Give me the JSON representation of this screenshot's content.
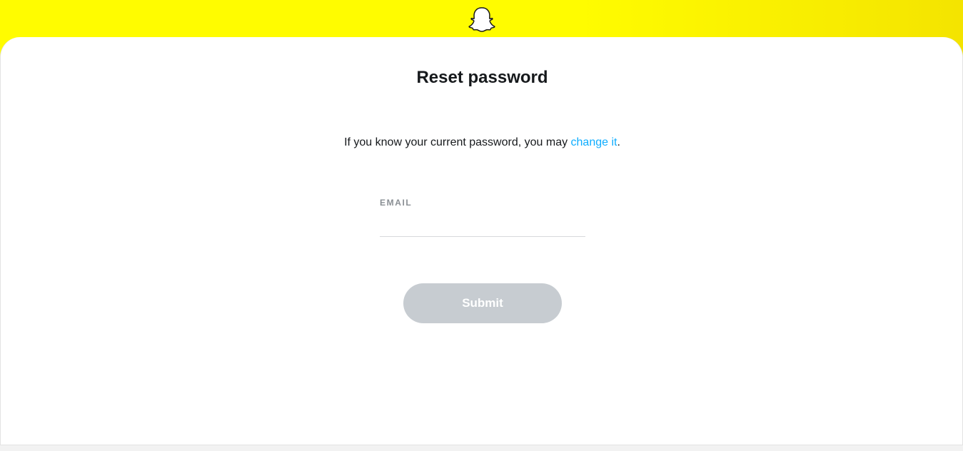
{
  "header": {
    "logo_icon": "ghost-icon",
    "background_color": "#fffc00"
  },
  "main": {
    "title": "Reset password",
    "hint_prefix": "If you know your current password, you may ",
    "hint_link": "change it",
    "hint_suffix": ".",
    "link_color": "#0eadff"
  },
  "form": {
    "email_label": "EMAIL",
    "email_value": "",
    "submit_label": "Submit",
    "submit_state": "disabled"
  }
}
